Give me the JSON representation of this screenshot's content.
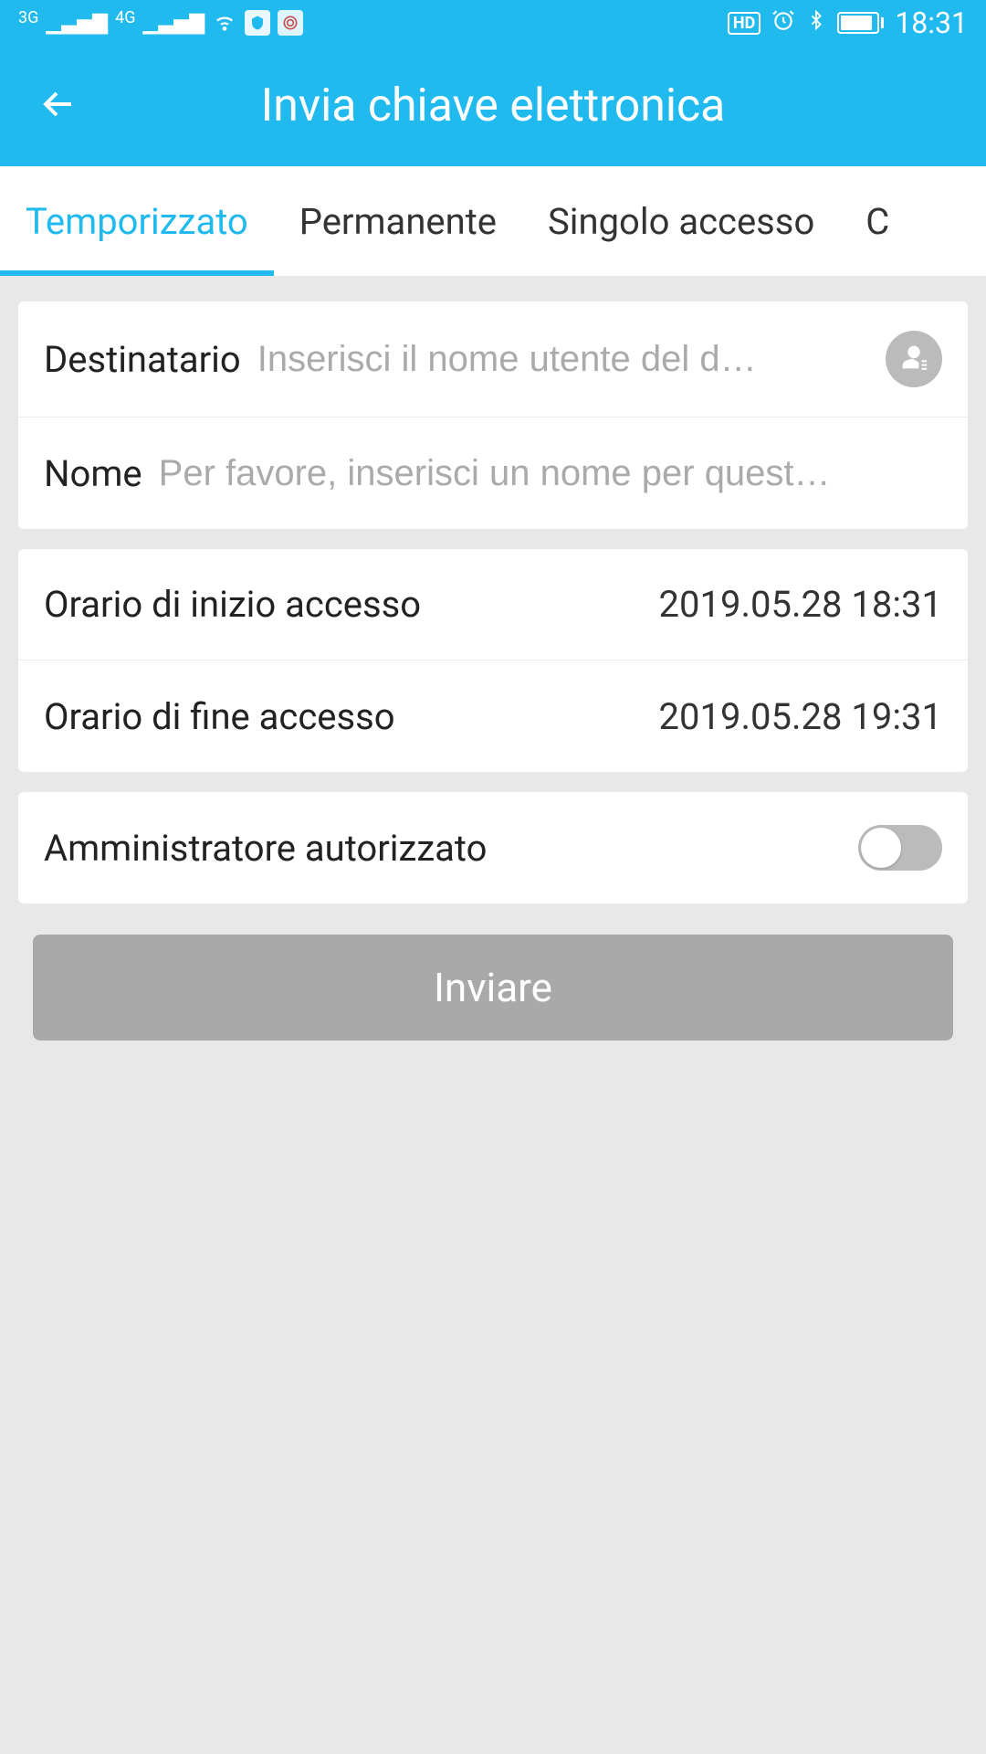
{
  "status_bar": {
    "net1": "3G",
    "net2": "4G",
    "hd": "HD",
    "time": "18:31"
  },
  "header": {
    "title": "Invia chiave elettronica"
  },
  "tabs": [
    {
      "label": "Temporizzato",
      "active": true
    },
    {
      "label": "Permanente",
      "active": false
    },
    {
      "label": "Singolo accesso",
      "active": false
    },
    {
      "label": "C",
      "active": false
    }
  ],
  "form": {
    "recipient_label": "Destinatario",
    "recipient_placeholder": "Inserisci il nome utente del d…",
    "name_label": "Nome",
    "name_placeholder": "Per favore, inserisci un nome per quest…",
    "start_label": "Orario di inizio accesso",
    "start_value": "2019.05.28 18:31",
    "end_label": "Orario di fine accesso",
    "end_value": "2019.05.28 19:31",
    "admin_label": "Amministratore autorizzato",
    "admin_on": false
  },
  "send_button": "Inviare"
}
